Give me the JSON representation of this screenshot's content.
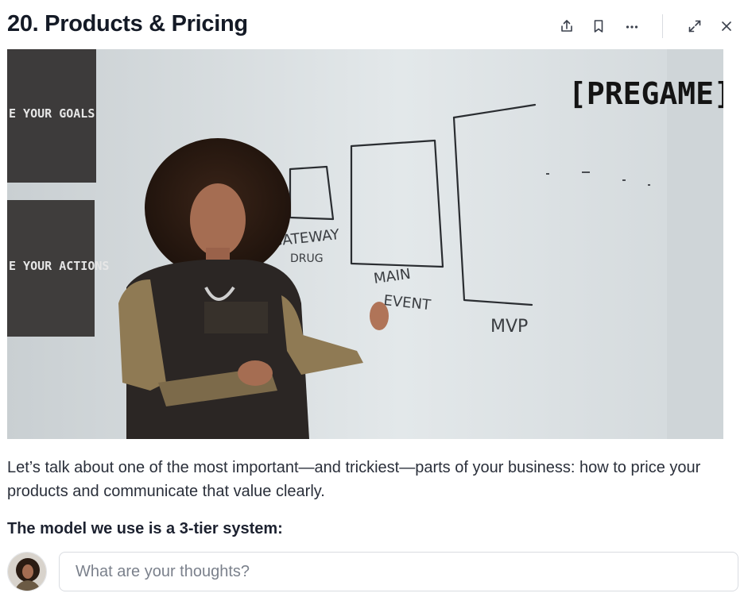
{
  "header": {
    "title": "20. Products & Pricing"
  },
  "toolbar": {
    "icons": [
      "share-icon",
      "bookmark-icon",
      "more-icon",
      "expand-icon",
      "close-icon"
    ]
  },
  "video": {
    "brand_text": "[PREGAME]",
    "wall_panel_1": "E YOUR GOALS",
    "wall_panel_2": "E YOUR ACTIONS",
    "board_label_gateway": "GATEWAY",
    "board_label_gateway_2": "DRUG",
    "board_label_main": "MAIN",
    "board_label_event": "EVENT",
    "board_label_mvp": "MVP"
  },
  "content": {
    "paragraph": "Let’s talk about one of the most important—and trickiest—parts of your business: how to price your products and communicate that value clearly.",
    "subheading": "The model we use is a 3-tier system:"
  },
  "comment": {
    "placeholder": "What are your thoughts?"
  },
  "colors": {
    "title": "#141a26",
    "border": "#d9dce1",
    "icon": "#3a404c"
  }
}
